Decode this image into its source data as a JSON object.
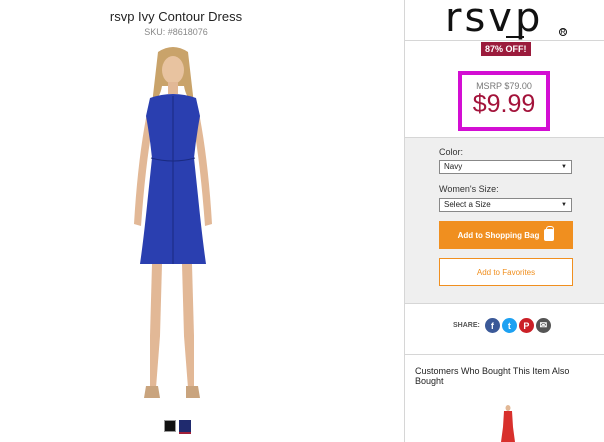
{
  "product": {
    "title": "rsvp Ivy Contour Dress",
    "sku": "SKU: #8618076",
    "swatches": [
      "black",
      "navy"
    ]
  },
  "brand": {
    "logo_text": "rsvp",
    "registered_mark": "R",
    "discount_badge": "87% OFF!"
  },
  "pricing": {
    "msrp": "MSRP $79.00",
    "price": "$9.99"
  },
  "options": {
    "color_label": "Color:",
    "color_value": "Navy",
    "size_label": "Women's Size:",
    "size_value": "Select a Size"
  },
  "actions": {
    "add_to_bag": "Add to Shopping Bag",
    "add_to_favorites": "Add to Favorites"
  },
  "share": {
    "label": "SHARE:",
    "networks": [
      "facebook-icon",
      "twitter-icon",
      "pinterest-icon",
      "email-icon"
    ]
  },
  "recommendations": {
    "heading": "Customers Who Bought This Item Also Bought"
  },
  "colors": {
    "accent_orange": "#f08f1f",
    "price_red": "#a3123a",
    "badge_red": "#9b1b3c",
    "highlight_magenta": "#d30ed3",
    "dress_blue": "#2a3fb0"
  }
}
